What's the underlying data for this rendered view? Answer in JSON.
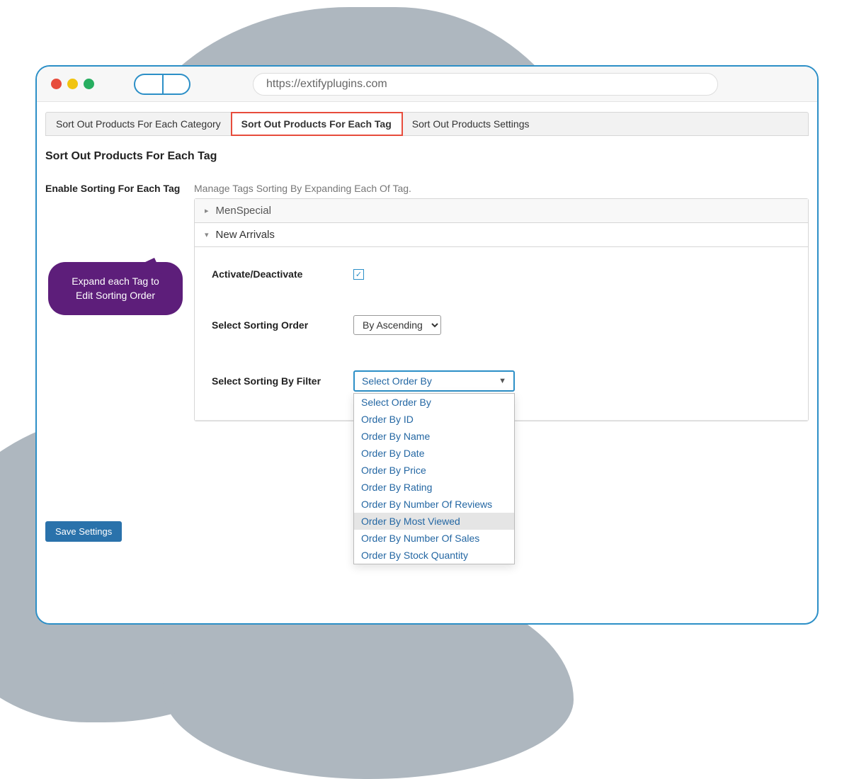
{
  "browser": {
    "url": "https://extifyplugins.com"
  },
  "tabs": {
    "category": "Sort Out Products For Each Category",
    "tag": "Sort Out Products For Each Tag",
    "settings": "Sort Out Products Settings"
  },
  "page_title": "Sort Out Products For Each Tag",
  "form": {
    "enable_label": "Enable Sorting For Each Tag",
    "hint": "Manage Tags Sorting By Expanding Each Of Tag.",
    "accordion": {
      "item1": "MenSpecial",
      "item2": "New Arrivals"
    },
    "fields": {
      "activate_label": "Activate/Deactivate",
      "order_label": "Select Sorting Order",
      "order_value": "By Ascending",
      "filter_label": "Select Sorting By Filter",
      "filter_selected": "Select Order By"
    }
  },
  "dropdown": {
    "o0": "Select Order By",
    "o1": "Order By ID",
    "o2": "Order By Name",
    "o3": "Order By Date",
    "o4": "Order By Price",
    "o5": "Order By Rating",
    "o6": "Order By Number Of Reviews",
    "o7": "Order By Most Viewed",
    "o8": "Order By Number Of Sales",
    "o9": "Order By Stock Quantity"
  },
  "save_label": "Save Settings",
  "callout_text": "Expand each Tag to Edit Sorting Order"
}
